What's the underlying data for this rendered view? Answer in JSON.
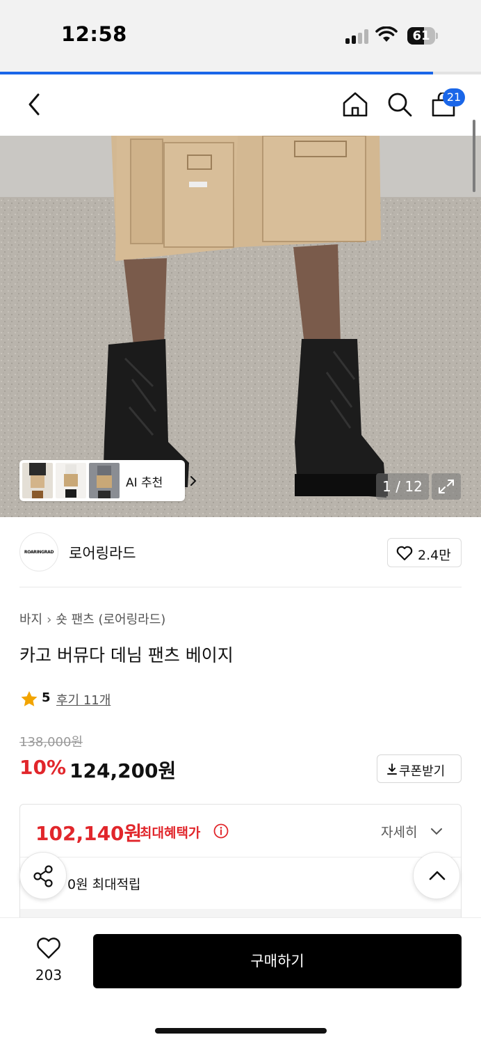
{
  "status_bar": {
    "time": "12:58",
    "battery": "61",
    "battery_level": 0.61
  },
  "page_load_progress": 0.9,
  "nav": {
    "cart_count": "21"
  },
  "gallery": {
    "ai_recommend_label": "AI 추천",
    "counter": "1 / 12"
  },
  "brand": {
    "logo_text": "ROARINGRAD",
    "name": "로어링라드",
    "likes": "2.4만"
  },
  "product": {
    "breadcrumb": [
      "바지",
      "숏 팬츠 (로어링라드)"
    ],
    "title": "카고 버뮤다 데님 팬츠 베이지",
    "rating": "5",
    "reviews": "후기 11개",
    "original_price": "138,000원",
    "discount_rate": "10%",
    "sale_price": "124,200원",
    "coupon_button": "쿠폰받기"
  },
  "benefit": {
    "max_benefit_price": "102,140원",
    "max_benefit_label": "최대혜택가",
    "detail_link": "자세히",
    "points_text": "0원 최대적립"
  },
  "bottom_bar": {
    "like_count": "203",
    "buy_button": "구매하기"
  },
  "colors": {
    "accent_blue": "#1a66e8",
    "price_red": "#e1262b",
    "buy_black": "#000000"
  }
}
